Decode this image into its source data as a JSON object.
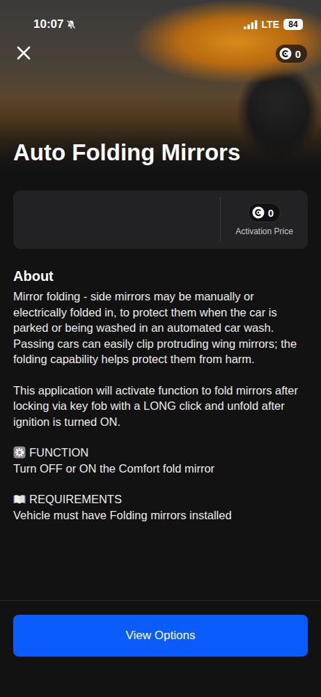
{
  "status_bar": {
    "time": "10:07",
    "silent": true,
    "network": "LTE",
    "battery": "84"
  },
  "header": {
    "title": "Auto Folding Mirrors",
    "balance": "0"
  },
  "price_card": {
    "price": "0",
    "label": "Activation Price"
  },
  "about": {
    "heading": "About",
    "paragraphs": [
      "Mirror folding - side mirrors may be manually or electrically folded in, to protect them when the car is parked or being washed in an automated car wash. Passing cars can easily clip protruding wing mirrors; the folding capability helps protect them from harm.",
      "This application will activate function to fold mirrors after locking via key fob with a LONG click and unfold after ignition is turned ON."
    ]
  },
  "sections": [
    {
      "heading": "FUNCTION",
      "text": "Turn OFF or ON the Comfort fold mirror"
    },
    {
      "heading": "REQUIREMENTS",
      "text": "Vehicle must have Folding mirrors installed"
    }
  ],
  "button": {
    "label": "View Options"
  }
}
